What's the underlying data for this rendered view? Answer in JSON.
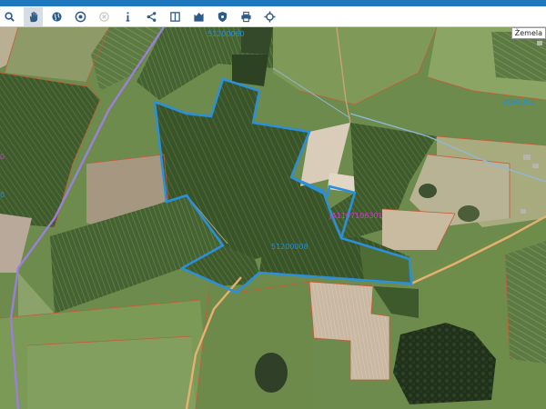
{
  "toolbar": {
    "tools": [
      {
        "name": "zoom-tool-button",
        "icon": "magnifier-icon",
        "active": false
      },
      {
        "name": "pan-tool-button",
        "icon": "hand-icon",
        "active": true
      },
      {
        "name": "globe-tool-button",
        "icon": "globe-icon",
        "active": false
      },
      {
        "name": "layers-target-button",
        "icon": "target-icon",
        "active": false
      },
      {
        "name": "disabled-tool-button",
        "icon": "circle-x-icon",
        "active": false
      },
      {
        "name": "info-button",
        "icon": "info-icon",
        "active": false
      },
      {
        "name": "share-button",
        "icon": "share-icon",
        "active": false
      },
      {
        "name": "compare-button",
        "icon": "split-view-icon",
        "active": false
      },
      {
        "name": "chart-button",
        "icon": "bar-chart-icon",
        "active": false
      },
      {
        "name": "shield-button",
        "icon": "shield-icon",
        "active": false
      },
      {
        "name": "print-button",
        "icon": "printer-icon",
        "active": false
      },
      {
        "name": "locate-button",
        "icon": "crosshair-icon",
        "active": false
      }
    ]
  },
  "map": {
    "layer_label": "Žemela",
    "labels": {
      "top_parcel": "51200060",
      "right_parcel": "2090001",
      "left_purple": "0",
      "left_blue": "0",
      "selected_parcel": "JA1107106301",
      "center_parcel": "51200008"
    },
    "colors": {
      "selection_outline": "#2b8fd9",
      "cadastre_line": "#c85a3a",
      "admin_boundary": "#9b7fd9",
      "road": "#e8b070",
      "label_blue": "#1f8fe0",
      "label_purple": "#d23bd2"
    }
  }
}
